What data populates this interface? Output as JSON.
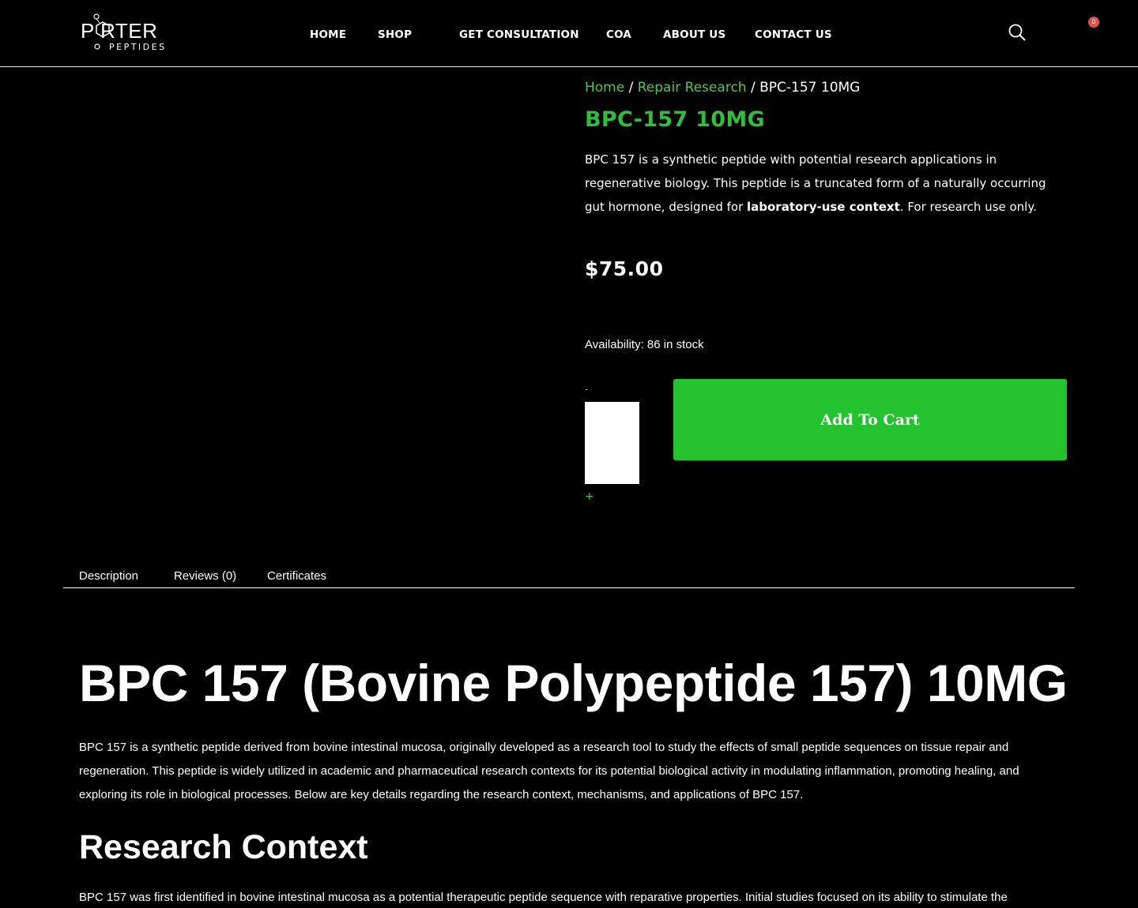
{
  "header": {
    "logo_main": "P RTER",
    "logo_sub": "PEPTIDES",
    "nav": [
      {
        "label": "HOME"
      },
      {
        "label": "SHOP"
      },
      {
        "label": "GET CONSULTATION"
      },
      {
        "label": "COA"
      },
      {
        "label": "ABOUT US"
      },
      {
        "label": "CONTACT US"
      }
    ],
    "cart_count": "0",
    "icons": {
      "search": "search-icon",
      "cart": "cart-icon"
    }
  },
  "product": {
    "breadcrumb": {
      "home": "Home",
      "category": "Repair Research",
      "separator": "/",
      "current": "BPC-157 10MG"
    },
    "title": "BPC-157 10MG",
    "short_description": {
      "part1": "BPC 157 is a synthetic peptide with potential research applications in regenerative biology. This peptide is a truncated form of a naturally occurring gut hormone, designed for ",
      "bold": "laboratory-use context",
      "part2": ". For research use only."
    },
    "price": "$75.00",
    "availability": "Availability: 86 in stock",
    "quantity": {
      "minus": "-",
      "plus": "+",
      "value": ""
    },
    "add_to_cart_label": "Add To Cart"
  },
  "tabs": [
    {
      "label": "Description"
    },
    {
      "label": "Reviews (0)"
    },
    {
      "label": "Certificates"
    }
  ],
  "description": {
    "title": "BPC 157 (Bovine Polypeptide 157) 10MG",
    "intro": "BPC 157 is a synthetic peptide derived from bovine intestinal mucosa, originally developed as a research tool to study the effects of small peptide sequences on tissue repair and regeneration. This peptide is widely utilized in academic and pharmaceutical research contexts for its potential biological activity in modulating inflammation, promoting healing, and exploring its role in biological processes. Below are key details regarding the research context, mechanisms, and applications of BPC 157.",
    "research_title": "Research Context",
    "research_para": "BPC 157 was first identified in bovine intestinal mucosa as a potential therapeutic peptide sequence with reparative properties. Initial studies focused on its ability to stimulate the"
  },
  "colors": {
    "accent_green": "#24c22e",
    "link_green": "#4cc94c",
    "badge_red": "#e2504a",
    "background": "#000000"
  }
}
